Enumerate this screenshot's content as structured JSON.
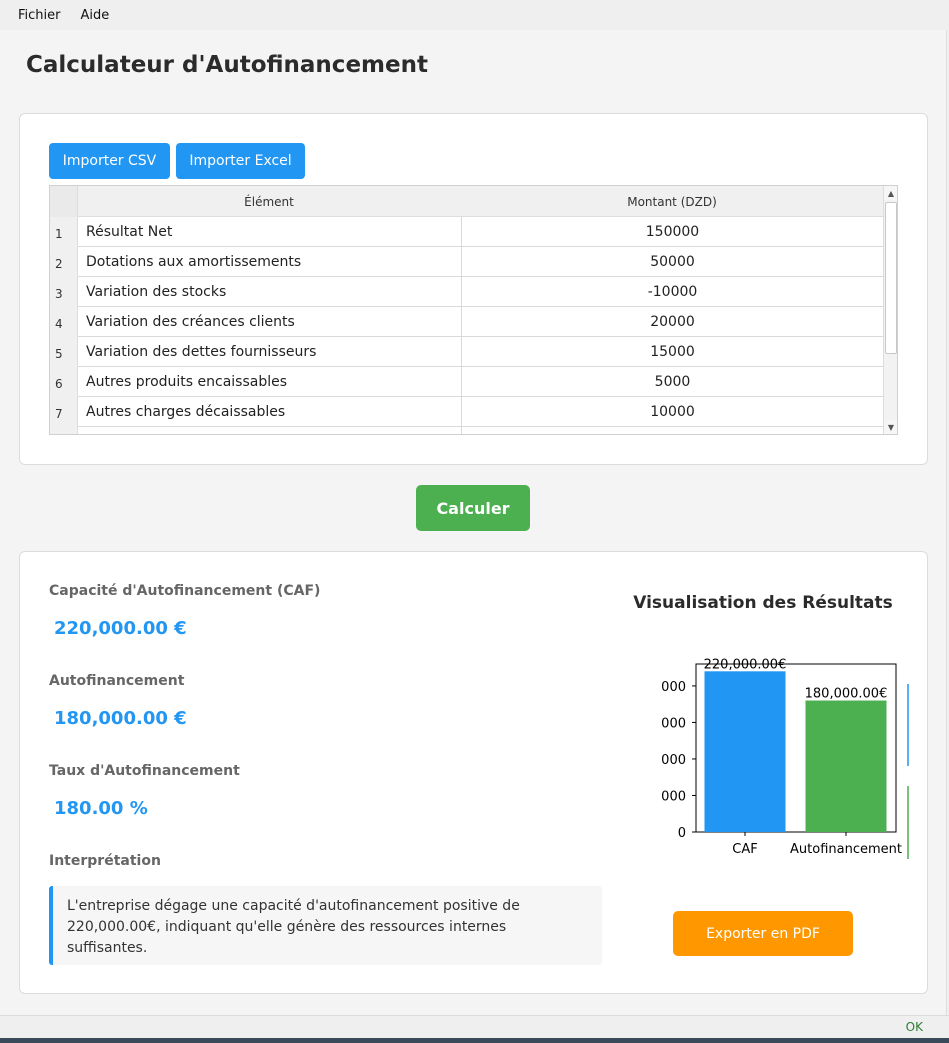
{
  "menu": {
    "items": [
      "Fichier",
      "Aide"
    ]
  },
  "title": "Calculateur d'Autofinancement",
  "import": {
    "csv_label": "Importer CSV",
    "excel_label": "Importer Excel"
  },
  "table": {
    "headers": {
      "element": "Élément",
      "amount": "Montant (DZD)"
    },
    "rows": [
      {
        "n": "1",
        "element": "Résultat Net",
        "amount": "150000"
      },
      {
        "n": "2",
        "element": "Dotations aux amortissements",
        "amount": "50000"
      },
      {
        "n": "3",
        "element": "Variation des stocks",
        "amount": "-10000"
      },
      {
        "n": "4",
        "element": "Variation des créances clients",
        "amount": "20000"
      },
      {
        "n": "5",
        "element": "Variation des dettes fournisseurs",
        "amount": "15000"
      },
      {
        "n": "6",
        "element": "Autres produits encaissables",
        "amount": "5000"
      },
      {
        "n": "7",
        "element": "Autres charges décaissables",
        "amount": "10000"
      }
    ]
  },
  "calculate_label": "Calculer",
  "results": {
    "caf_label": "Capacité d'Autofinancement (CAF)",
    "caf_value": "220,000.00 €",
    "auto_label": "Autofinancement",
    "auto_value": "180,000.00 €",
    "taux_label": "Taux d'Autofinancement",
    "taux_value": "180.00 %",
    "interp_label": "Interprétation",
    "interp_text": "L'entreprise dégage une capacité d'autofinancement positive de 220,000.00€, indiquant qu'elle génère des ressources internes suffisantes."
  },
  "chart_title": "Visualisation des Résultats",
  "chart_data": {
    "type": "bar",
    "categories": [
      "CAF",
      "Autofinancement"
    ],
    "values": [
      220000,
      180000
    ],
    "data_labels": [
      "220,000.00€",
      "180,000.00€"
    ],
    "y_tick_labels": [
      "0",
      "000",
      "000",
      "000",
      "000"
    ],
    "ylim": [
      0,
      230000
    ],
    "colors": [
      "#2196F3",
      "#4CAF50"
    ],
    "title": "",
    "xlabel": "",
    "ylabel": ""
  },
  "export_label": "Exporter en PDF",
  "status": "OK"
}
